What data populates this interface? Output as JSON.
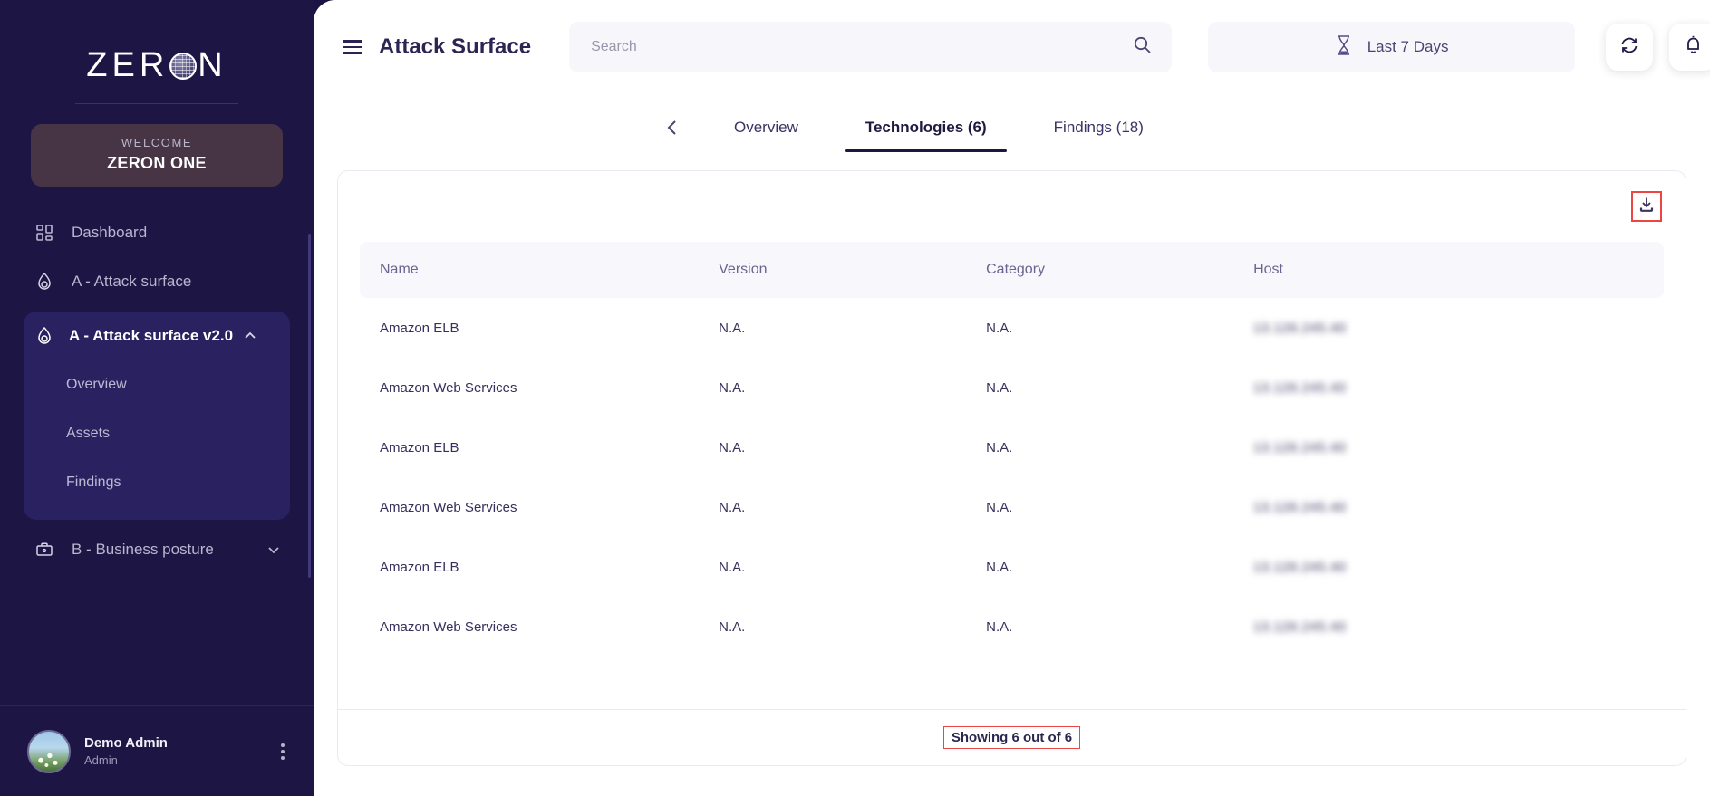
{
  "brand": {
    "logo_text_before": "ZER",
    "logo_glyph": "globe-icon",
    "logo_text_after": "N",
    "welcome_label": "WELCOME",
    "org_name": "ZERON ONE",
    "sidebar_bg": "#1d1645",
    "welcome_card_bg": "#473444",
    "active_group_bg": "#2a2160",
    "accent": "#1d1640",
    "annotation_red": "#ef4444"
  },
  "sidebar": {
    "items": [
      {
        "label": "Dashboard",
        "icon": "grid-dashboard-icon",
        "expandable": false,
        "active": false
      },
      {
        "label": "A - Attack surface",
        "icon": "flame-drop-icon",
        "expandable": false,
        "active": false
      },
      {
        "label": "A - Attack surface v2.0",
        "icon": "flame-drop-icon",
        "expandable": true,
        "expanded": true,
        "chevron": "chevron-up-icon",
        "active": true,
        "children": [
          "Overview",
          "Assets",
          "Findings"
        ]
      },
      {
        "label": "B - Business posture",
        "icon": "briefcase-icon",
        "expandable": true,
        "expanded": false,
        "chevron": "chevron-down-icon",
        "active": false
      }
    ],
    "profile": {
      "name": "Demo Admin",
      "role": "Admin",
      "avatar": "user-avatar-photo",
      "menu_icon": "kebab-menu-icon"
    }
  },
  "header": {
    "menu_icon": "hamburger-menu-icon",
    "title": "Attack Surface",
    "search": {
      "value": "",
      "placeholder": "Search",
      "icon": "search-icon"
    },
    "date_range": {
      "label": "Last 7 Days",
      "icon": "hourglass-icon"
    },
    "refresh_icon": "refresh-sync-icon",
    "notification_icon": "bell-notification-icon"
  },
  "tabs": {
    "back_icon": "chevron-left-icon",
    "items": [
      {
        "label": "Overview",
        "active": false
      },
      {
        "label": "Technologies (6)",
        "active": true
      },
      {
        "label": "Findings (18)",
        "active": false
      }
    ]
  },
  "table": {
    "download_icon": "download-icon",
    "columns": [
      "Name",
      "Version",
      "Category",
      "Host"
    ],
    "rows": [
      {
        "name": "Amazon ELB",
        "version": "N.A.",
        "category": "N.A.",
        "host": "13.126.245.40"
      },
      {
        "name": "Amazon Web Services",
        "version": "N.A.",
        "category": "N.A.",
        "host": "13.126.245.40"
      },
      {
        "name": "Amazon ELB",
        "version": "N.A.",
        "category": "N.A.",
        "host": "13.126.245.40"
      },
      {
        "name": "Amazon Web Services",
        "version": "N.A.",
        "category": "N.A.",
        "host": "13.126.245.40"
      },
      {
        "name": "Amazon ELB",
        "version": "N.A.",
        "category": "N.A.",
        "host": "13.126.245.40"
      },
      {
        "name": "Amazon Web Services",
        "version": "N.A.",
        "category": "N.A.",
        "host": "13.126.245.40"
      }
    ],
    "footer_text": "Showing 6 out of 6"
  }
}
